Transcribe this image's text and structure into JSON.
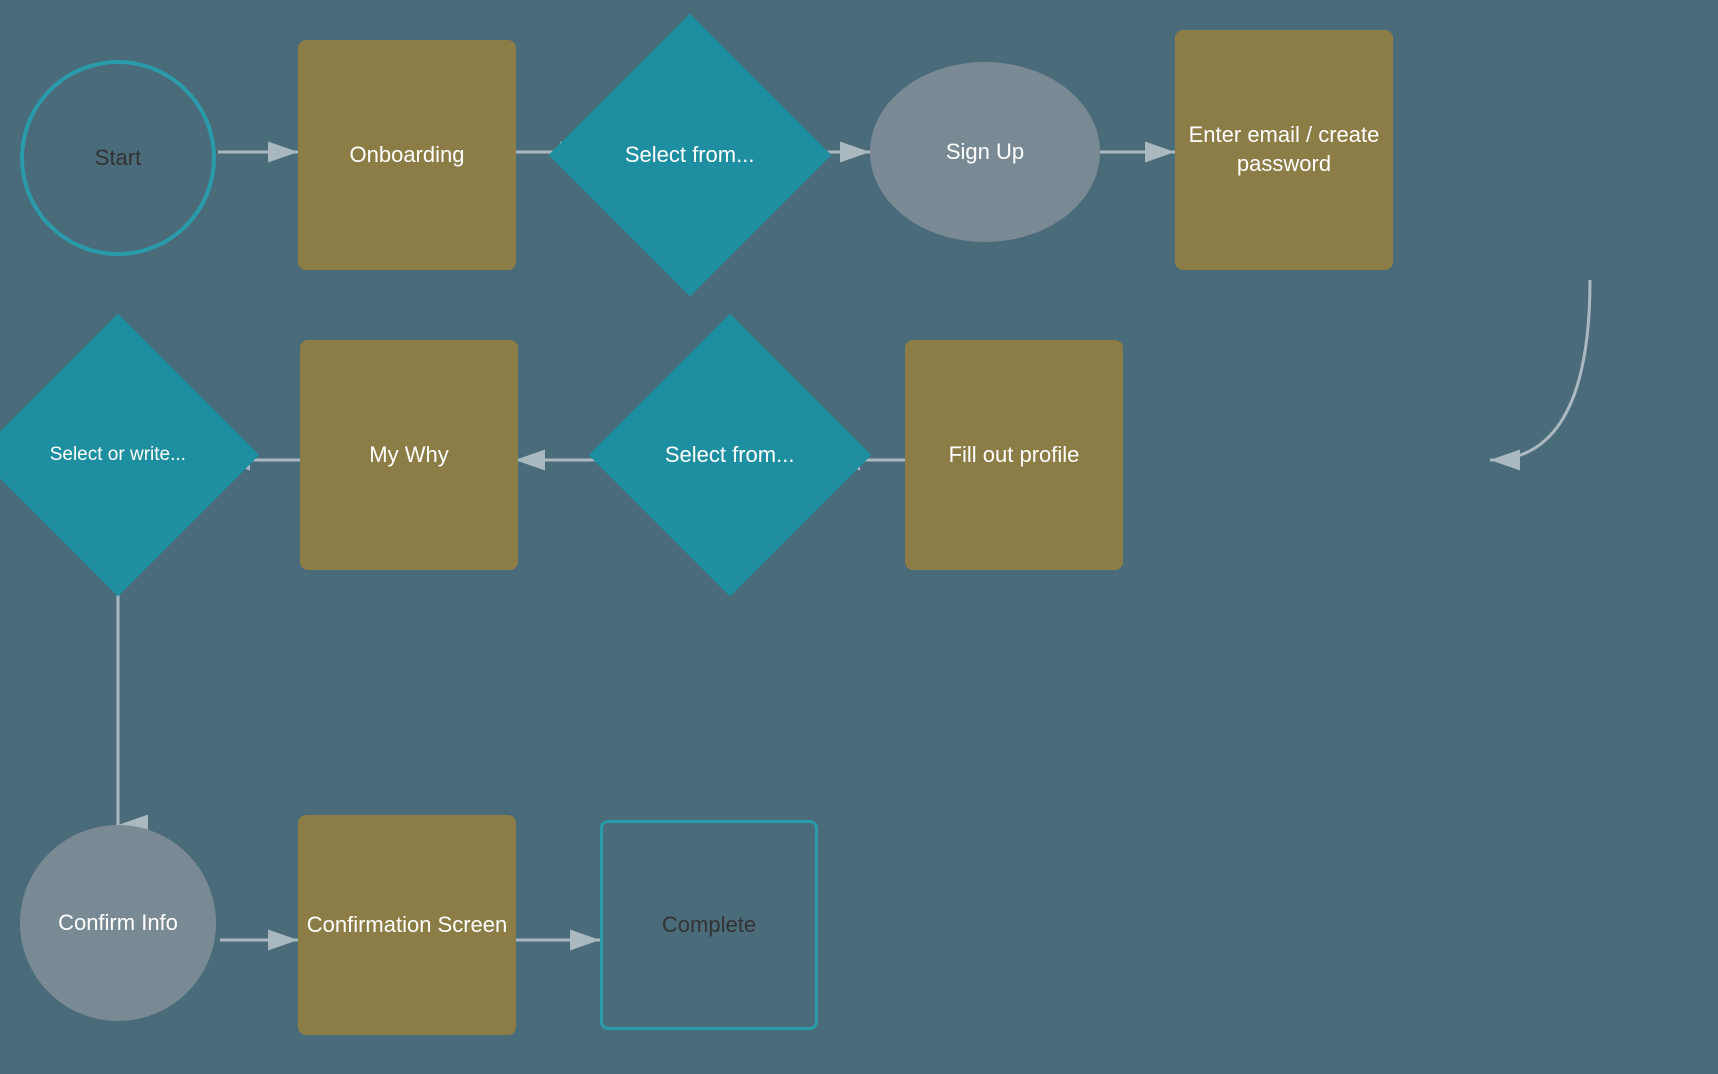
{
  "nodes": {
    "start": {
      "label": "Start"
    },
    "onboarding": {
      "label": "Onboarding"
    },
    "select1": {
      "label": "Select from..."
    },
    "signup": {
      "label": "Sign Up"
    },
    "enter_email": {
      "label": "Enter email / create password"
    },
    "fill_profile": {
      "label": "Fill out profile"
    },
    "select2": {
      "label": "Select from..."
    },
    "my_why": {
      "label": "My Why"
    },
    "select_write": {
      "label": "Select or write..."
    },
    "confirm_info": {
      "label": "Confirm Info"
    },
    "confirmation_screen": {
      "label": "Confirmation Screen"
    },
    "complete": {
      "label": "Complete"
    }
  },
  "colors": {
    "background": "#4a6b7a",
    "teal": "#1e8fa0",
    "tan": "#8b7d45",
    "gray": "#7a8a94",
    "arrow": "#aab8c0"
  }
}
